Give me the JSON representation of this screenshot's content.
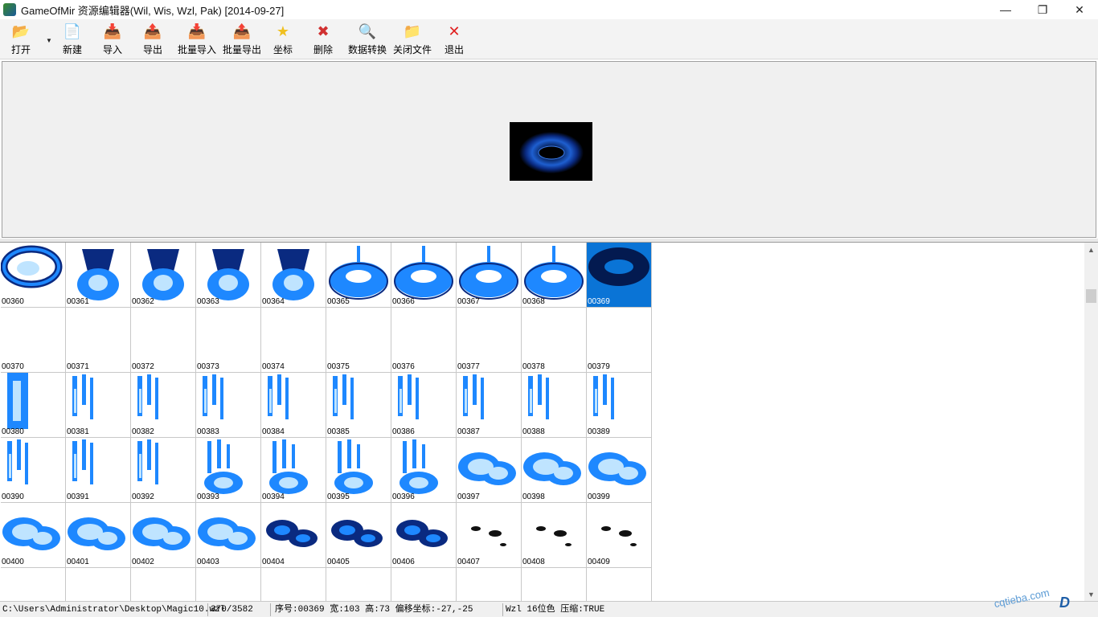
{
  "window": {
    "title": "GameOfMir 资源编辑器(Wil, Wis, Wzl, Pak) [2014-09-27]",
    "min_glyph": "—",
    "restore_glyph": "❐",
    "close_glyph": "✕"
  },
  "toolbar": {
    "buttons": [
      {
        "label": "打开",
        "icon": "open-folder-icon",
        "glyph": "📂"
      },
      {
        "label": "新建",
        "icon": "new-file-icon",
        "glyph": "📄"
      },
      {
        "label": "导入",
        "icon": "import-icon",
        "glyph": "📥"
      },
      {
        "label": "导出",
        "icon": "export-icon",
        "glyph": "📤"
      },
      {
        "label": "批量导入",
        "icon": "batch-import-icon",
        "glyph": "📥"
      },
      {
        "label": "批量导出",
        "icon": "batch-export-icon",
        "glyph": "📤"
      },
      {
        "label": "坐标",
        "icon": "star-icon",
        "glyph": "★"
      },
      {
        "label": "删除",
        "icon": "delete-icon",
        "glyph": "✖"
      },
      {
        "label": "数据转换",
        "icon": "convert-icon",
        "glyph": "🔍"
      },
      {
        "label": "关闭文件",
        "icon": "close-file-icon",
        "glyph": "📁"
      },
      {
        "label": "退出",
        "icon": "exit-icon",
        "glyph": "✕"
      }
    ]
  },
  "thumbnails": [
    {
      "label": "00360",
      "kind": "swirl"
    },
    {
      "label": "00361",
      "kind": "tornado"
    },
    {
      "label": "00362",
      "kind": "tornado"
    },
    {
      "label": "00363",
      "kind": "tornado"
    },
    {
      "label": "00364",
      "kind": "tornado"
    },
    {
      "label": "00365",
      "kind": "ring"
    },
    {
      "label": "00366",
      "kind": "ring"
    },
    {
      "label": "00367",
      "kind": "ring"
    },
    {
      "label": "00368",
      "kind": "ring"
    },
    {
      "label": "00369",
      "kind": "ringdark"
    },
    {
      "label": "00370",
      "kind": "empty"
    },
    {
      "label": "00371",
      "kind": "empty"
    },
    {
      "label": "00372",
      "kind": "empty"
    },
    {
      "label": "00373",
      "kind": "empty"
    },
    {
      "label": "00374",
      "kind": "empty"
    },
    {
      "label": "00375",
      "kind": "empty"
    },
    {
      "label": "00376",
      "kind": "empty"
    },
    {
      "label": "00377",
      "kind": "empty"
    },
    {
      "label": "00378",
      "kind": "empty"
    },
    {
      "label": "00379",
      "kind": "empty"
    },
    {
      "label": "00380",
      "kind": "pillar"
    },
    {
      "label": "00381",
      "kind": "shards"
    },
    {
      "label": "00382",
      "kind": "shards"
    },
    {
      "label": "00383",
      "kind": "shards"
    },
    {
      "label": "00384",
      "kind": "shards"
    },
    {
      "label": "00385",
      "kind": "shards"
    },
    {
      "label": "00386",
      "kind": "shards"
    },
    {
      "label": "00387",
      "kind": "shards"
    },
    {
      "label": "00388",
      "kind": "shards"
    },
    {
      "label": "00389",
      "kind": "shards"
    },
    {
      "label": "00390",
      "kind": "shards"
    },
    {
      "label": "00391",
      "kind": "shards"
    },
    {
      "label": "00392",
      "kind": "shards"
    },
    {
      "label": "00393",
      "kind": "shardcloud"
    },
    {
      "label": "00394",
      "kind": "shardcloud"
    },
    {
      "label": "00395",
      "kind": "shardcloud"
    },
    {
      "label": "00396",
      "kind": "shardcloud"
    },
    {
      "label": "00397",
      "kind": "cloud"
    },
    {
      "label": "00398",
      "kind": "cloud"
    },
    {
      "label": "00399",
      "kind": "cloud"
    },
    {
      "label": "00400",
      "kind": "cloud"
    },
    {
      "label": "00401",
      "kind": "cloud"
    },
    {
      "label": "00402",
      "kind": "cloud"
    },
    {
      "label": "00403",
      "kind": "cloud"
    },
    {
      "label": "00404",
      "kind": "clouddark"
    },
    {
      "label": "00405",
      "kind": "clouddark"
    },
    {
      "label": "00406",
      "kind": "clouddark"
    },
    {
      "label": "00407",
      "kind": "specks"
    },
    {
      "label": "00408",
      "kind": "specks"
    },
    {
      "label": "00409",
      "kind": "specks"
    },
    {
      "label": "",
      "kind": "empty"
    },
    {
      "label": "",
      "kind": "empty"
    },
    {
      "label": "",
      "kind": "empty"
    },
    {
      "label": "",
      "kind": "empty"
    },
    {
      "label": "",
      "kind": "empty"
    },
    {
      "label": "",
      "kind": "empty"
    },
    {
      "label": "",
      "kind": "empty"
    },
    {
      "label": "",
      "kind": "empty"
    },
    {
      "label": "",
      "kind": "empty"
    },
    {
      "label": "",
      "kind": "empty"
    }
  ],
  "selected_label": "00369",
  "colors": {
    "selection": "#0a74d6",
    "effect_blue": "#1e88ff",
    "effect_light": "#bfe4ff"
  },
  "status": {
    "path": "C:\\Users\\Administrator\\Desktop\\Magic10.wzl",
    "count": "370/3582",
    "info": "序号:00369 宽:103 高:73 偏移坐标:-27,-25",
    "format": "Wzl 16位色 压缩:TRUE"
  },
  "watermark": {
    "text": "cqtieba.com",
    "logo": "D"
  }
}
